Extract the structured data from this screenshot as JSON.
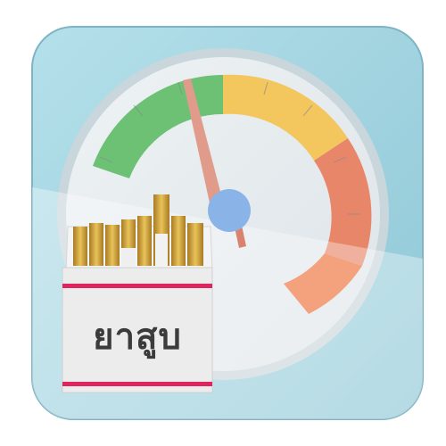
{
  "app_icon": {
    "icon_name": "tobacco-meter-icon",
    "background_color": "#9fd3e0",
    "gauge": {
      "zones": [
        {
          "name": "green",
          "color": "#6cc174"
        },
        {
          "name": "yellow",
          "color": "#f4c75e"
        },
        {
          "name": "salmon",
          "color": "#e8866a"
        },
        {
          "name": "orange",
          "color": "#ee6f3a"
        }
      ],
      "needle_color": "#e09b8a",
      "hub_color": "#8ab4e8"
    },
    "pack": {
      "label": "ยาสูบ",
      "stripe_color": "#e0245e",
      "filter_color": "#d4a843"
    }
  }
}
